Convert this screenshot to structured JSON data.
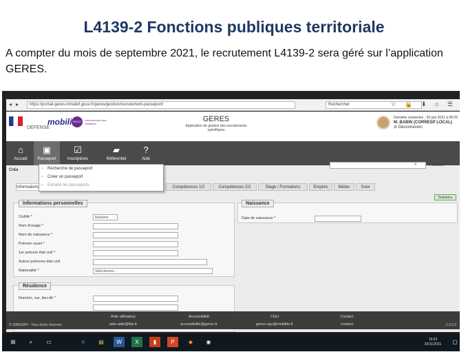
{
  "slide": {
    "title": "L4139-2 Fonctions publiques territoriale",
    "body": "A compter du mois de septembre 2021, le recrutement L4139-2 sera géré sur l’application GERES."
  },
  "browser": {
    "url": "https://portail-geres.intradef.gouv.fr/geres/gestion/recrutement-passeport/",
    "search_placeholder": "Rechercher",
    "icons": "☆ 🔒 ⬇ ⌂ ☰"
  },
  "app": {
    "defense_label": "DÉFENSE",
    "logo_text": "mobilité",
    "logo_ball": "RECO",
    "logo_tag": "reconversion des militaires",
    "name": "GERES",
    "subtitle": "Application de gestion des recrutements spécifiques",
    "user": {
      "line1": "Dernière connexion : 29 juin 2021 à 09:29",
      "line2": "M. BABIN (CORRESP LOCAL)",
      "line3": "⊘ Déconnexion"
    }
  },
  "nav": [
    {
      "label": "Accueil",
      "icon": "⌂"
    },
    {
      "label": "Passeport",
      "icon": "▣"
    },
    {
      "label": "Inscriptions",
      "icon": "☑"
    },
    {
      "label": "Référentiel",
      "icon": "▰"
    },
    {
      "label": "Aide",
      "icon": "?"
    }
  ],
  "nav_search": {
    "button": "⌕",
    "advanced": "▾ avancée"
  },
  "breadcrumb": "Créa",
  "dropdown": [
    {
      "label": "Recherche de passeport",
      "disabled": false
    },
    {
      "label": "Créer un passeport",
      "disabled": false
    },
    {
      "label": "Extraire les passeports",
      "disabled": true
    }
  ],
  "tabs": [
    "Informations",
    "Compétences 1/2",
    "Compétences 2/2",
    "Stage / Formations",
    "Emplois",
    "Métier",
    "Suivi"
  ],
  "next_button": "Suivant ▸",
  "personal": {
    "legend": "Informations personnelles",
    "fields": [
      {
        "label": "Civilité *",
        "value": "Madame"
      },
      {
        "label": "Nom d'usage *",
        "value": ""
      },
      {
        "label": "Nom de naissance *",
        "value": ""
      },
      {
        "label": "Prénom usuel *",
        "value": ""
      },
      {
        "label": "1er prénom état civil *",
        "value": ""
      },
      {
        "label": "Autres prénoms état civil",
        "value": ""
      },
      {
        "label": "Nationalité *",
        "value": "Sélectionner..."
      }
    ]
  },
  "birth": {
    "legend": "Naissance",
    "date_label": "Date de naissance *"
  },
  "residence": {
    "legend": "Résidence",
    "fields": [
      {
        "label": "Numéro, rue, lieu-dit *"
      }
    ]
  },
  "footer": {
    "columns": [
      {
        "title": "Aide utilisateur",
        "link": "aide.aide@fda.fr"
      },
      {
        "title": "Accessibilité",
        "link": "accessibilite@geres.fr"
      },
      {
        "title": "CGU",
        "link": "geres-cgu@mobilite.fr"
      },
      {
        "title": "Contact",
        "link": "contact"
      }
    ],
    "left": "© SIREGRH - Tous droits réservés",
    "right": "2.3.0.0"
  },
  "taskbar": {
    "time": "19:53",
    "date": "29/11/2021",
    "apps": [
      "⊞",
      "⌕",
      "▭",
      "e",
      "▤",
      "W",
      "X",
      "▮",
      "P",
      "◆",
      "◉"
    ]
  }
}
